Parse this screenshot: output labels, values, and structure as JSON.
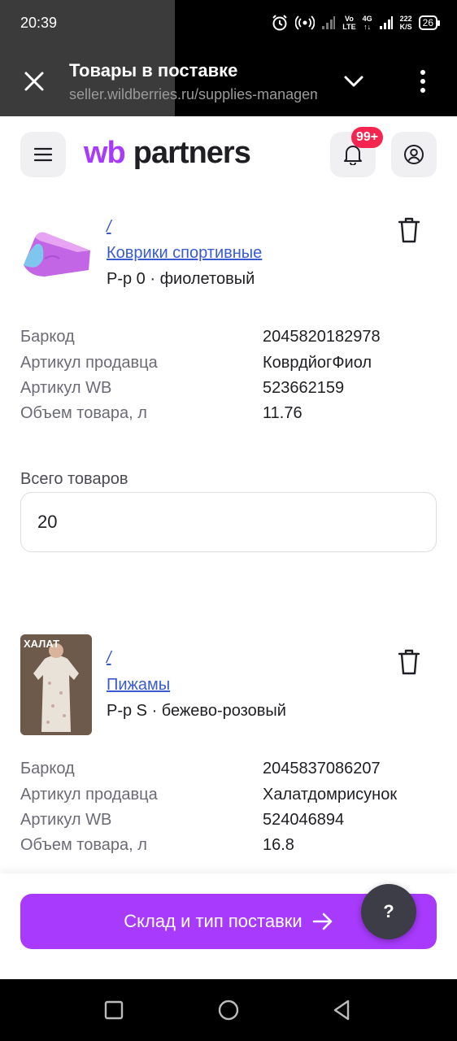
{
  "status_bar": {
    "time": "20:39",
    "volte": "Vo",
    "lte": "LTE",
    "net_type": "4G",
    "speed_value": "222",
    "speed_unit": "K/S",
    "battery": "26"
  },
  "browser": {
    "title": "Товары в поставке",
    "url": "seller.wildberries.ru/supplies-management"
  },
  "header": {
    "logo_wb": "wb",
    "logo_partners": "partners",
    "notification_badge": "99+"
  },
  "products": [
    {
      "slash": "/",
      "category": "Коврики спортивные",
      "variant": "Р-р 0 · фиолетовый",
      "specs": [
        {
          "label": "Баркод",
          "value": "2045820182978"
        },
        {
          "label": "Артикул продавца",
          "value": "КоврдйогФиол"
        },
        {
          "label": "Артикул WB",
          "value": "523662159"
        },
        {
          "label": "Объем товара, л",
          "value": "11.76"
        }
      ],
      "total_label": "Всего товаров",
      "total_value": "20"
    },
    {
      "slash": "/",
      "category": "Пижамы",
      "variant": "Р-р S · бежево-розовый",
      "thumb_text": "ХАЛАТ",
      "specs": [
        {
          "label": "Баркод",
          "value": "2045837086207"
        },
        {
          "label": "Артикул продавца",
          "value": "Халатдомрисунок"
        },
        {
          "label": "Артикул WB",
          "value": "524046894"
        },
        {
          "label": "Объем товара, л",
          "value": "16.8"
        }
      ]
    }
  ],
  "footer": {
    "cta_label": "Склад и тип поставки",
    "help_label": "?"
  },
  "colors": {
    "accent": "#a73afd",
    "badge": "#f5254f",
    "link": "#3a5bd0"
  }
}
